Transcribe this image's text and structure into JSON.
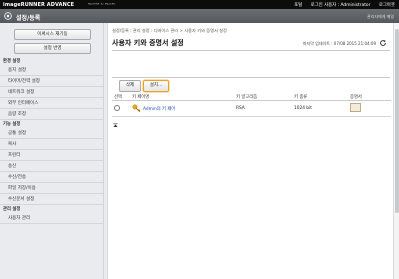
{
  "topbar": {
    "product": "imageRUNNER ADVANCE",
    "device": "ᴹᴬᶜᴴᴵᴺᴱ ᴵᴰ ᴹᴬˢᴷᴱᴰ",
    "links": [
      "포털",
      "로그인 사용자 : Administrator",
      "로그아웃"
    ]
  },
  "titlebar": {
    "title": "설정/등록",
    "admin_link": "관리자에게 메일"
  },
  "sidebar": {
    "buttons": [
      "이써시스 재기동",
      "설정 반영"
    ],
    "sections": [
      {
        "label": "환경 설정",
        "items": [
          "용지 설정",
          "타이머/전력 설정",
          "네트워크 설정",
          "외부 인터페이스",
          "음량 조정"
        ]
      },
      {
        "label": "기능 설정",
        "items": [
          "공통 설정",
          "복사",
          "프린터",
          "송신",
          "수신/전송",
          "파일 저장/이용",
          "수신문서 설정"
        ]
      },
      {
        "label": "관리 설정",
        "items": [
          "사용자 관리"
        ]
      }
    ]
  },
  "main": {
    "breadcrumb": "설정/등록 : 관리 설정 : 디바이스 관리 > 사용자 키와 증명서 설정",
    "title": "사용자 키와 증명서 설정",
    "updated": "마지막 업데이트 : 07/08 2015 21:04:09",
    "buttons": {
      "delete": "삭제",
      "settings": "설치..."
    },
    "table": {
      "headers": [
        "선택",
        "키 페어명",
        "키 알고리즘",
        "키 종류",
        "증명서"
      ],
      "rows": [
        {
          "name": "Admin의 키 페어",
          "algorithm": "RSA",
          "type": "1024 bit"
        }
      ]
    }
  },
  "colors": {
    "accent_highlight": "#f0a020",
    "topbar": "#0c0c0c",
    "titlebar": "#5f6267"
  }
}
